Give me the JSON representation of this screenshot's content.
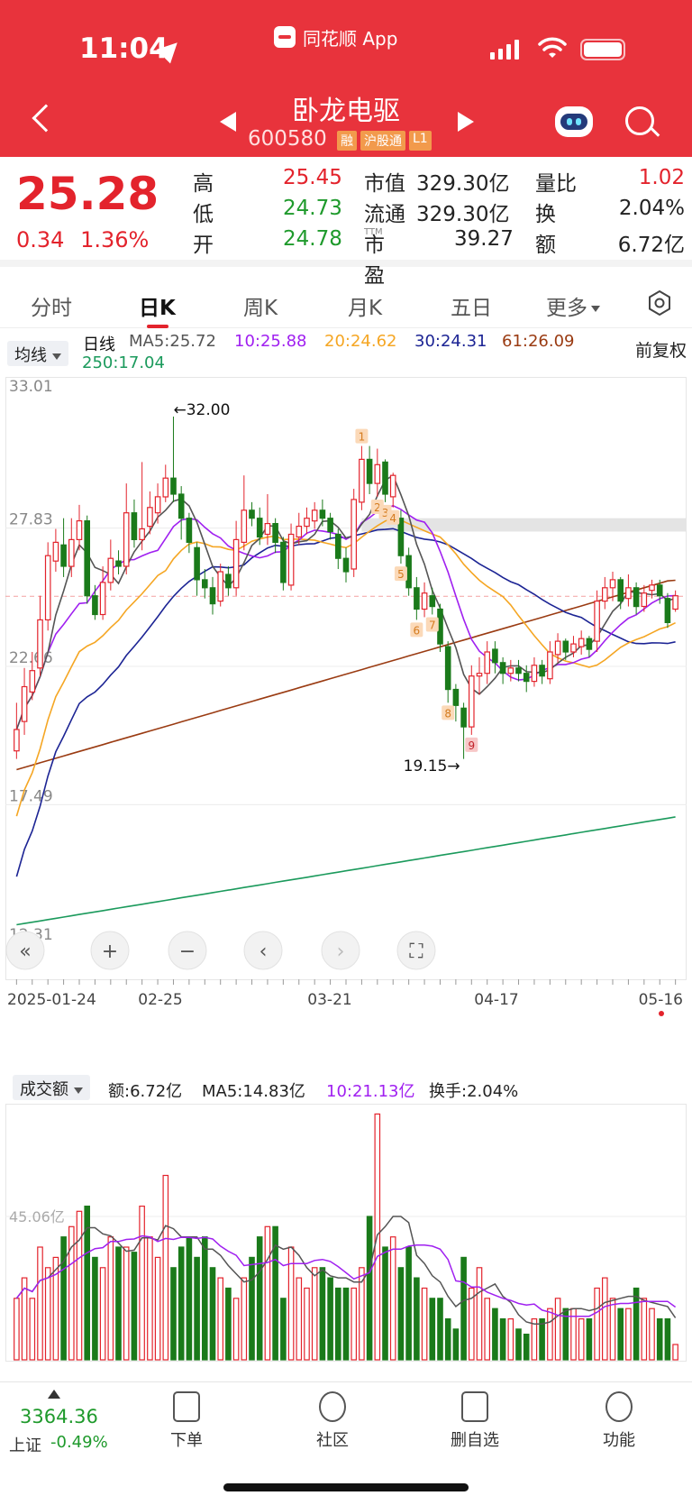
{
  "status": {
    "time": "11:04",
    "app_name": "同花顺 App"
  },
  "stock": {
    "name": "卧龙电驱",
    "code": "600580",
    "tags": [
      "融",
      "沪股通",
      "L1"
    ],
    "price": "25.28",
    "change": "0.34",
    "change_pct": "1.36%"
  },
  "quote": {
    "high_label": "高",
    "high": "25.45",
    "low_label": "低",
    "low": "24.73",
    "open_label": "开",
    "open": "24.78",
    "mcap_label": "市值",
    "mcap": "329.30亿",
    "float_label": "流通",
    "float": "329.30亿",
    "pe_label": "市盈",
    "pe_sup": "TTM",
    "pe": "39.27",
    "vr_label": "量比",
    "vr": "1.02",
    "turnover_label": "换",
    "turnover": "2.04%",
    "amount_label": "额",
    "amount": "6.72亿"
  },
  "tabs": [
    "分时",
    "日K",
    "周K",
    "月K",
    "五日",
    "更多"
  ],
  "active_tab": "日K",
  "ma_legend": {
    "selector": "均线",
    "period": "日线",
    "ma5": "MA5:25.72",
    "ma10": "10:25.88",
    "ma20": "20:24.62",
    "ma30": "30:24.31",
    "ma61": "61:26.09",
    "ma250": "250:17.04",
    "adjust": "前复权"
  },
  "colors": {
    "up": "#e3232c",
    "down": "#1a7a1a",
    "ma5": "#555555",
    "ma10": "#a020f0",
    "ma20": "#f5a623",
    "ma30": "#1c2494",
    "ma61": "#9a3b12",
    "ma250": "#1b9a5c"
  },
  "chart_data": {
    "type": "candlestick",
    "ylim": [
      12.31,
      33.01
    ],
    "y_ticks": [
      "33.01",
      "27.83",
      "22.66",
      "17.49",
      "12.31"
    ],
    "x_ticks": [
      "2025-01-24",
      "02-25",
      "03-21",
      "04-17",
      "05-16"
    ],
    "annotations": {
      "high": "←32.00",
      "low": "19.15→"
    },
    "signal_labels": [
      "1",
      "2",
      "3",
      "4",
      "5",
      "6",
      "7",
      "8",
      "9"
    ],
    "candles": [
      [
        19.5,
        20.3,
        19.2,
        21.3
      ],
      [
        20.6,
        21.9,
        20.1,
        22.6
      ],
      [
        21.7,
        22.5,
        21.4,
        23.2
      ],
      [
        22.6,
        24.4,
        22.3,
        25.3
      ],
      [
        24.4,
        26.8,
        24.0,
        27.3
      ],
      [
        26.6,
        27.3,
        26.2,
        27.8
      ],
      [
        27.2,
        26.4,
        26.0,
        28.2
      ],
      [
        26.4,
        27.4,
        26.0,
        28.2
      ],
      [
        27.4,
        28.1,
        27.0,
        28.7
      ],
      [
        28.1,
        25.3,
        25.0,
        28.3
      ],
      [
        25.3,
        24.6,
        24.4,
        25.7
      ],
      [
        24.6,
        25.8,
        24.4,
        26.4
      ],
      [
        25.8,
        26.7,
        25.5,
        27.4
      ],
      [
        26.6,
        26.4,
        26.1,
        27.0
      ],
      [
        26.4,
        28.4,
        26.1,
        29.5
      ],
      [
        28.4,
        27.4,
        27.1,
        28.9
      ],
      [
        27.4,
        27.8,
        27.0,
        30.3
      ],
      [
        27.9,
        28.6,
        27.6,
        29.2
      ],
      [
        28.4,
        29.0,
        28.0,
        29.5
      ],
      [
        29.0,
        29.7,
        28.8,
        30.2
      ],
      [
        29.7,
        29.1,
        28.8,
        32.0
      ],
      [
        29.1,
        28.2,
        27.4,
        29.4
      ],
      [
        28.2,
        27.3,
        26.9,
        28.4
      ],
      [
        27.1,
        25.9,
        25.3,
        27.3
      ],
      [
        25.9,
        25.6,
        25.2,
        26.3
      ],
      [
        25.6,
        25.0,
        24.6,
        26.0
      ],
      [
        25.1,
        26.2,
        24.9,
        26.5
      ],
      [
        26.1,
        25.6,
        25.3,
        26.4
      ],
      [
        25.6,
        27.4,
        25.3,
        28.1
      ],
      [
        27.3,
        28.5,
        27.0,
        29.8
      ],
      [
        28.5,
        28.2,
        27.9,
        28.8
      ],
      [
        28.2,
        27.5,
        27.2,
        28.6
      ],
      [
        27.6,
        28.0,
        27.2,
        29.1
      ],
      [
        28.0,
        27.3,
        26.9,
        28.2
      ],
      [
        27.3,
        25.8,
        25.5,
        27.5
      ],
      [
        25.7,
        27.6,
        25.5,
        28.0
      ],
      [
        27.5,
        27.9,
        27.2,
        28.4
      ],
      [
        27.9,
        28.2,
        27.6,
        28.6
      ],
      [
        28.1,
        28.5,
        27.8,
        28.8
      ],
      [
        28.5,
        28.2,
        27.9,
        28.9
      ],
      [
        28.2,
        27.7,
        27.4,
        28.4
      ],
      [
        27.6,
        26.7,
        26.3,
        27.8
      ],
      [
        26.7,
        26.2,
        25.8,
        27.1
      ],
      [
        26.3,
        28.9,
        26.0,
        29.3
      ],
      [
        28.8,
        30.4,
        28.5,
        30.9
      ],
      [
        30.4,
        29.5,
        29.1,
        30.9
      ],
      [
        29.5,
        30.2,
        29.0,
        30.8
      ],
      [
        30.3,
        29.1,
        28.8,
        30.4
      ],
      [
        29.0,
        29.8,
        28.6,
        29.9
      ],
      [
        28.2,
        26.8,
        26.5,
        28.5
      ],
      [
        26.8,
        25.6,
        25.3,
        27.1
      ],
      [
        25.6,
        24.8,
        24.4,
        26.0
      ],
      [
        24.8,
        25.4,
        24.5,
        25.8
      ],
      [
        25.3,
        24.9,
        24.6,
        25.6
      ],
      [
        24.8,
        23.5,
        23.2,
        25.0
      ],
      [
        23.4,
        21.8,
        21.3,
        23.6
      ],
      [
        21.8,
        21.2,
        20.6,
        22.0
      ],
      [
        21.1,
        20.4,
        19.2,
        21.3
      ],
      [
        20.4,
        22.3,
        20.1,
        22.7
      ],
      [
        22.3,
        22.4,
        21.6,
        23.0
      ],
      [
        22.4,
        23.2,
        22.0,
        23.6
      ],
      [
        23.3,
        22.8,
        22.4,
        23.6
      ],
      [
        22.8,
        22.4,
        22.0,
        23.0
      ],
      [
        22.4,
        22.6,
        22.1,
        22.9
      ],
      [
        22.6,
        22.4,
        22.1,
        22.9
      ],
      [
        22.4,
        22.1,
        21.7,
        22.7
      ],
      [
        22.1,
        22.7,
        21.9,
        23.0
      ],
      [
        22.7,
        22.3,
        22.0,
        22.9
      ],
      [
        22.2,
        23.2,
        22.0,
        23.6
      ],
      [
        23.1,
        23.6,
        22.8,
        23.9
      ],
      [
        23.6,
        23.2,
        22.9,
        23.7
      ],
      [
        23.2,
        23.5,
        23.0,
        23.8
      ],
      [
        23.4,
        23.7,
        23.1,
        24.0
      ],
      [
        23.7,
        23.3,
        23.0,
        23.8
      ],
      [
        23.6,
        25.1,
        23.2,
        25.5
      ],
      [
        25.1,
        25.6,
        24.8,
        26.0
      ],
      [
        25.6,
        25.9,
        25.1,
        26.2
      ],
      [
        25.9,
        25.1,
        24.8,
        26.0
      ],
      [
        25.2,
        25.6,
        24.9,
        26.1
      ],
      [
        25.6,
        24.9,
        24.6,
        25.8
      ],
      [
        24.9,
        25.4,
        24.7,
        25.7
      ],
      [
        25.5,
        25.7,
        25.2,
        25.9
      ],
      [
        25.7,
        25.3,
        25.0,
        25.9
      ],
      [
        25.2,
        24.3,
        24.1,
        25.4
      ],
      [
        24.8,
        25.3,
        24.7,
        25.5
      ]
    ],
    "volume": {
      "ylabel": "成交额",
      "amount": "额:6.72亿",
      "ma5": "MA5:14.83亿",
      "ma10": "10:21.13亿",
      "turnover": "换手:2.04%",
      "ref_level": "45.06亿",
      "values": [
        12,
        16,
        12,
        22,
        18,
        20,
        24,
        26,
        29,
        30,
        20,
        18,
        24,
        22,
        22,
        21,
        30,
        24,
        20,
        36,
        18,
        22,
        24,
        20,
        24,
        18,
        16,
        14,
        12,
        16,
        20,
        24,
        26,
        26,
        12,
        22,
        16,
        14,
        18,
        18,
        16,
        14,
        14,
        14,
        18,
        28,
        48,
        22,
        24,
        18,
        22,
        16,
        14,
        12,
        12,
        8,
        6,
        20,
        14,
        18,
        12,
        10,
        8,
        8,
        6,
        5,
        8,
        8,
        10,
        12,
        10,
        10,
        8,
        8,
        14,
        16,
        12,
        10,
        10,
        14,
        12,
        10,
        8,
        8,
        3
      ],
      "ylim": [
        0,
        50
      ]
    }
  },
  "chart_controls": [
    "«",
    "+",
    "−",
    "‹",
    "›",
    "⛶"
  ],
  "bottom_nav": {
    "index_value": "3364.36",
    "index_name": "上证",
    "index_change": "-0.49%",
    "items": [
      "下单",
      "社区",
      "删自选",
      "功能"
    ]
  }
}
